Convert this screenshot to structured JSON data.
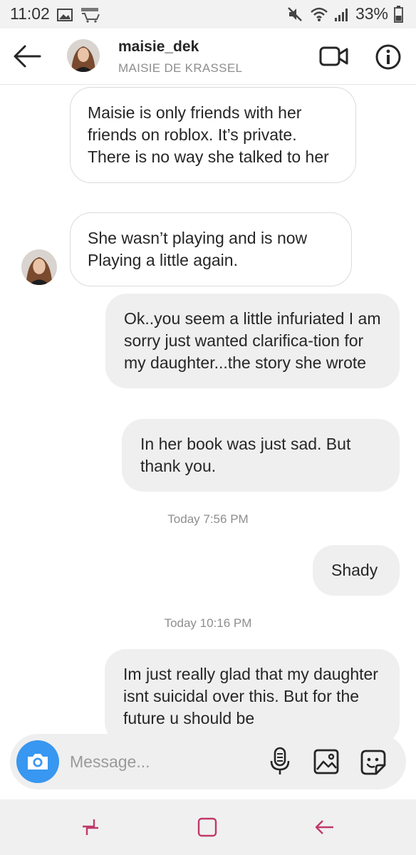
{
  "status_bar": {
    "time": "11:02",
    "battery": "33%",
    "icons": [
      "image-icon",
      "amazon-icon",
      "mute-icon",
      "wifi-icon",
      "signal-icon",
      "battery-icon"
    ]
  },
  "header": {
    "username": "maisie_dek",
    "full_name": "MAISIE DE KRASSEL",
    "icons": [
      "back-arrow-icon",
      "video-call-icon",
      "info-icon"
    ]
  },
  "messages": [
    {
      "direction": "incoming",
      "text": "Maisie is only friends with her friends on roblox.  It’s private. There is no way she talked to her"
    },
    {
      "direction": "incoming",
      "text": "She wasn’t playing and is now Playing a little again."
    },
    {
      "direction": "outgoing",
      "text": "Ok..you seem a little infuriated I am sorry just wanted clarifica-tion for my daughter...the story she wrote"
    },
    {
      "direction": "outgoing",
      "text": "In her book was just sad. But thank you."
    },
    {
      "type": "timestamp",
      "text": "Today 7:56 PM"
    },
    {
      "direction": "outgoing",
      "text": "Shady"
    },
    {
      "type": "timestamp",
      "text": "Today 10:16 PM"
    },
    {
      "direction": "outgoing",
      "text": "Im just really glad that my daughter isnt suicidal over this. But for the future u should be"
    }
  ],
  "composer": {
    "placeholder": "Message...",
    "icons": [
      "camera-icon",
      "microphone-icon",
      "gallery-icon",
      "sticker-icon"
    ]
  },
  "nav_bar": {
    "icons": [
      "recent-apps-icon",
      "home-icon",
      "back-icon"
    ]
  },
  "colors": {
    "accent": "#3897f0",
    "incoming_bubble_border": "#dbdbdb",
    "outgoing_bubble": "#efefef",
    "secondary_text": "#8e8e8e"
  }
}
